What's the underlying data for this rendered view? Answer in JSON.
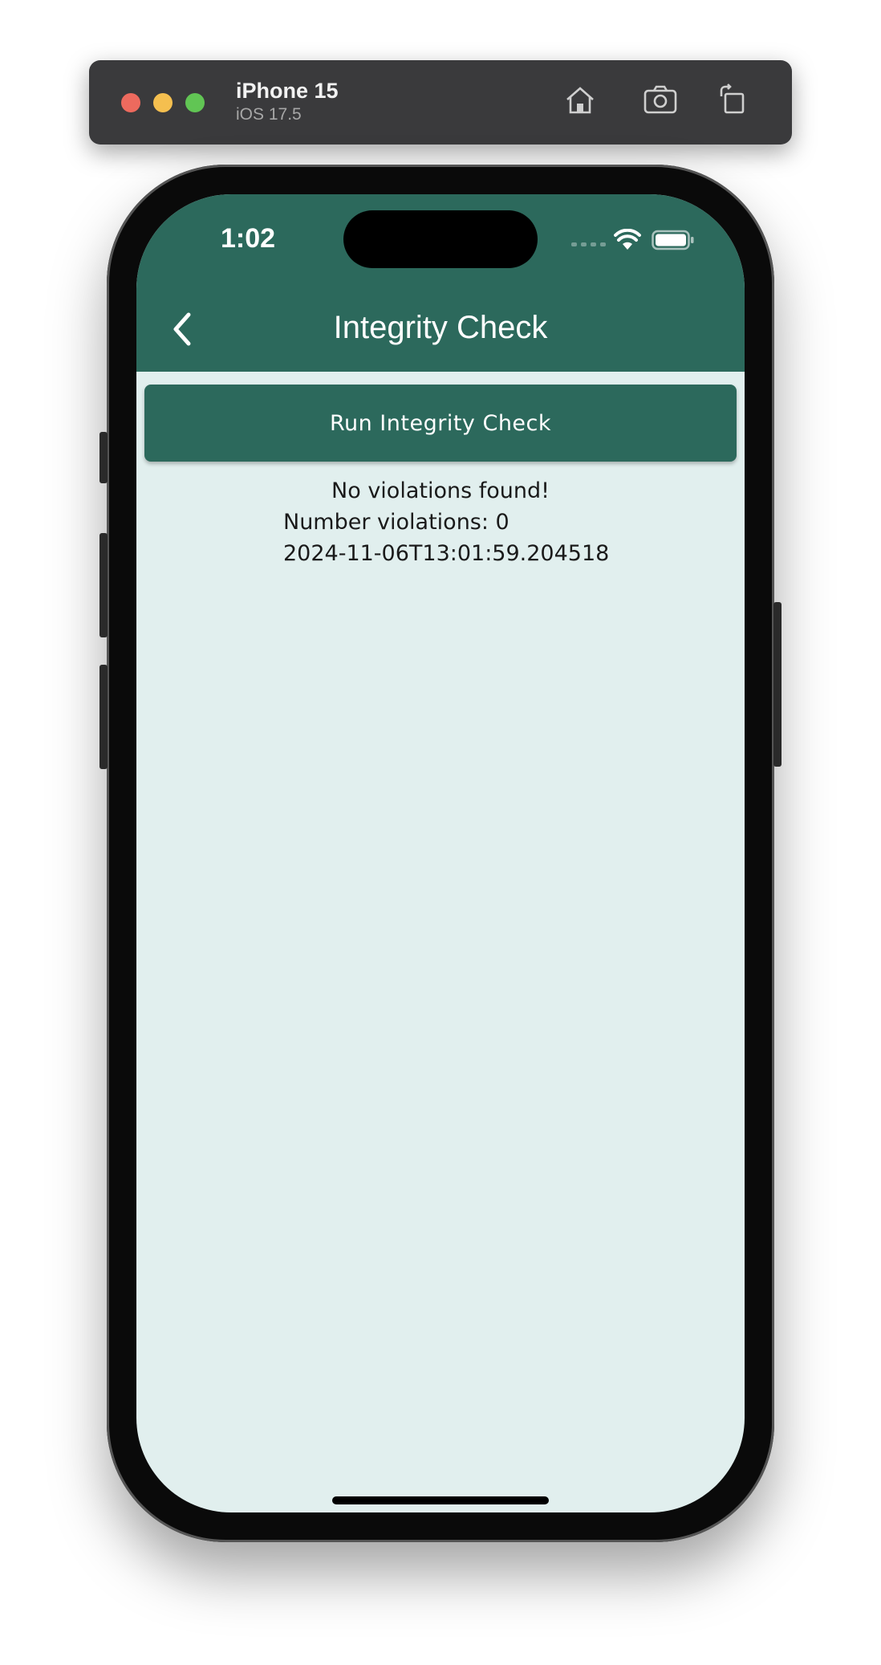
{
  "simulator": {
    "device_name": "iPhone 15",
    "os_version": "iOS 17.5",
    "toolbar_icons": [
      "home-icon",
      "screenshot-icon",
      "rotate-icon"
    ]
  },
  "status_bar": {
    "time": "1:02",
    "icons": [
      "cellular-signal-icon",
      "wifi-icon",
      "battery-icon"
    ]
  },
  "app_bar": {
    "title": "Integrity Check",
    "back_icon": "chevron-left-icon",
    "color": "#2c695c"
  },
  "actions": {
    "run_label": "Run Integrity Check"
  },
  "result": {
    "message": "No violations found!",
    "count_text": "Number violations: 0",
    "timestamp": "2024-11-06T13:01:59.204518"
  },
  "colors": {
    "accent": "#2c695c",
    "background": "#e1efee"
  }
}
